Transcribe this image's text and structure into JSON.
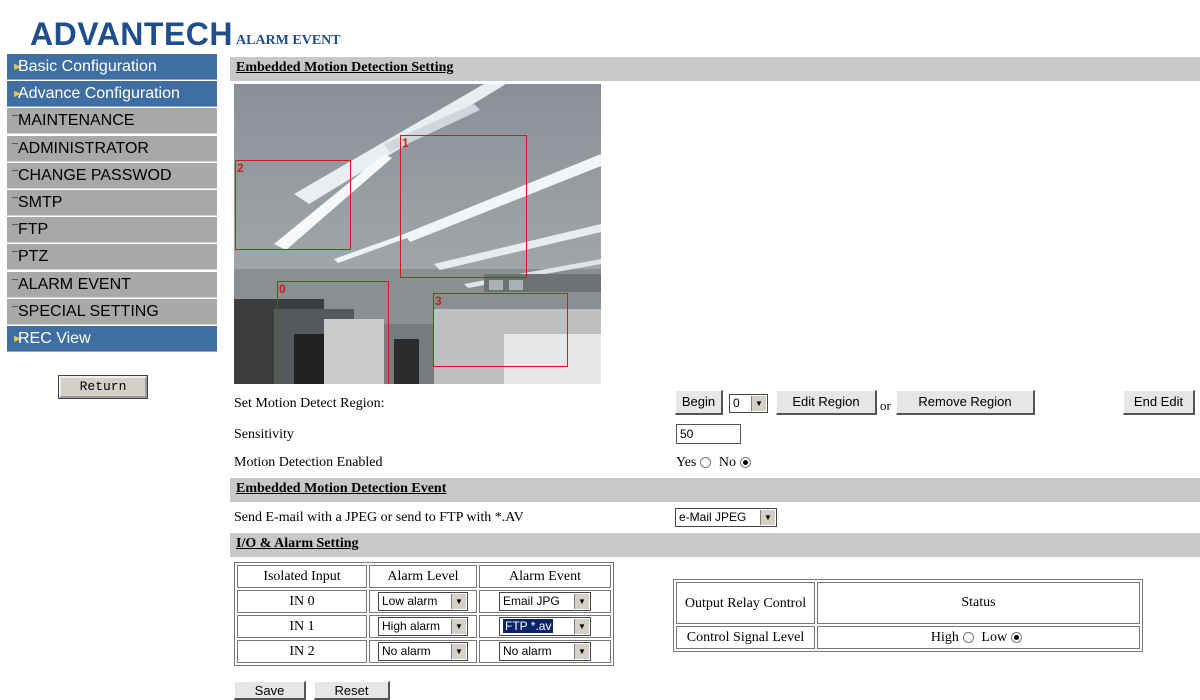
{
  "brand": {
    "logo_text": "ADVANTECH",
    "accent": "#1f4e8c"
  },
  "sidebar": {
    "items": [
      {
        "label": "Basic Configuration",
        "style": "blue"
      },
      {
        "label": "Advance Configuration",
        "style": "blue"
      },
      {
        "label": "MAINTENANCE",
        "style": "gray"
      },
      {
        "label": "ADMINISTRATOR",
        "style": "gray"
      },
      {
        "label": "CHANGE PASSWOD",
        "style": "gray"
      },
      {
        "label": "SMTP",
        "style": "gray"
      },
      {
        "label": "FTP",
        "style": "gray"
      },
      {
        "label": "PTZ",
        "style": "gray"
      },
      {
        "label": "ALARM EVENT",
        "style": "gray"
      },
      {
        "label": "SPECIAL SETTING",
        "style": "gray"
      },
      {
        "label": "REC View",
        "style": "blue"
      }
    ],
    "return_label": "Return"
  },
  "page": {
    "title": "ALARM EVENT"
  },
  "sections": {
    "motion_setting": "Embedded Motion Detection Setting",
    "motion_event": "Embedded Motion Detection Event",
    "io_alarm": "I/O & Alarm Setting"
  },
  "camera": {
    "regions": [
      {
        "id": "0"
      },
      {
        "id": "1"
      },
      {
        "id": "2"
      },
      {
        "id": "3"
      }
    ]
  },
  "motion": {
    "region_label": "Set Motion Detect Region:",
    "begin_label": "Begin",
    "region_select": "0",
    "edit_label": "Edit Region",
    "or_label": "or",
    "remove_label": "Remove Region",
    "end_label": "End Edit",
    "sensitivity_label": "Sensitivity",
    "sensitivity_value": "50",
    "enabled_label": "Motion Detection Enabled",
    "yes_label": "Yes",
    "no_label": "No",
    "enabled_value": "No"
  },
  "event": {
    "label": "Send E-mail with a JPEG or send to FTP with *.AV",
    "select": "e-Mail JPEG"
  },
  "io_table": {
    "headers": [
      "Isolated Input",
      "Alarm Level",
      "Alarm Event"
    ],
    "rows": [
      {
        "input": "IN 0",
        "level": "Low alarm",
        "event": "Email JPG"
      },
      {
        "input": "IN 1",
        "level": "High alarm",
        "event": "FTP *.av"
      },
      {
        "input": "IN 2",
        "level": "No alarm",
        "event": "No alarm"
      }
    ]
  },
  "relay_table": {
    "header_left": "Output Relay Control",
    "header_right": "Status",
    "row_label": "Control Signal Level",
    "high_label": "High",
    "low_label": "Low",
    "value": "Low"
  },
  "footer": {
    "save_label": "Save",
    "reset_label": "Reset"
  }
}
